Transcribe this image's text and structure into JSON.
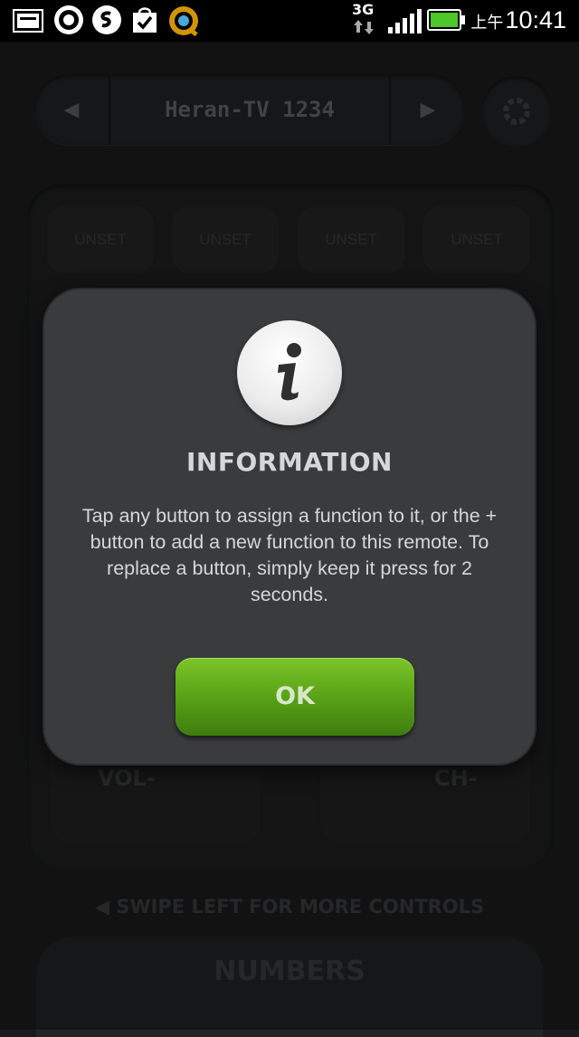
{
  "status_bar": {
    "network": "3G",
    "ampm": "上午",
    "time": "10:41",
    "icons": [
      "gallery-icon",
      "steam-icon",
      "shazam-icon",
      "shopping-bag-icon",
      "q-app-icon",
      "data-arrows-icon",
      "signal-icon",
      "battery-icon"
    ]
  },
  "remote": {
    "device_name": "Heran-TV 1234",
    "unset_buttons": [
      "UNSET",
      "UNSET",
      "UNSET",
      "UNSET"
    ],
    "vol_down": "VOL-",
    "ch_down": "CH-",
    "swipe_hint": "SWIPE LEFT FOR MORE CONTROLS",
    "numbers_label": "NUMBERS"
  },
  "dialog": {
    "title": "INFORMATION",
    "message": "Tap any button to assign a function to it, or the + button to add a new function to this remote. To replace a button, simply keep it press for 2 seconds.",
    "ok_label": "OK"
  },
  "colors": {
    "ok_green": "#5ba618",
    "battery_green": "#4cc628",
    "dialog_bg": "#3a3b3c"
  }
}
